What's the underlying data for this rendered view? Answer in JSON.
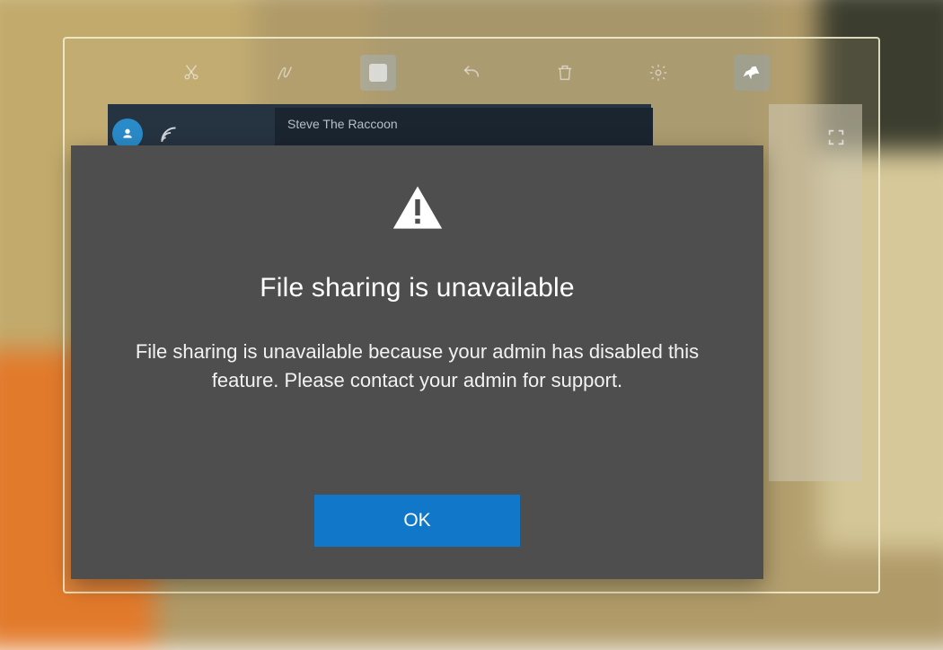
{
  "participant_name": "Steve The Raccoon",
  "dialog": {
    "title": "File sharing is unavailable",
    "message": "File sharing is unavailable because your admin has disabled this feature. Please contact your admin for support.",
    "confirm_label": "OK"
  },
  "toolbar": {
    "icons": [
      "cut-icon",
      "draw-icon",
      "stop-icon",
      "undo-icon",
      "trash-icon",
      "settings-icon",
      "pin-icon"
    ]
  },
  "colors": {
    "modal_bg": "#4e4e4e",
    "primary": "#1177c9",
    "dark_strip": "#263341"
  }
}
